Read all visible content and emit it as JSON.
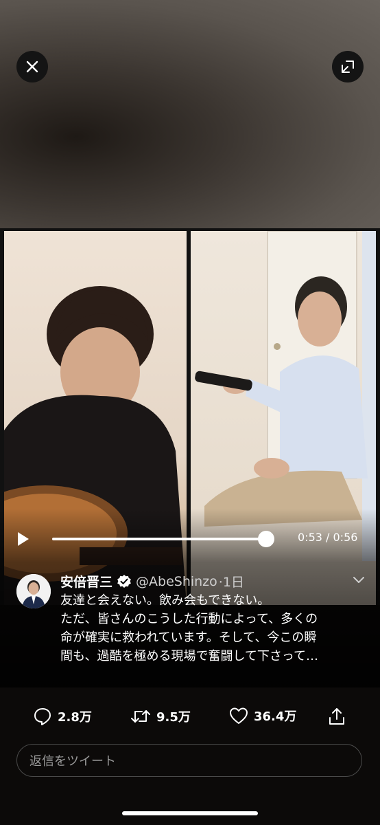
{
  "player": {
    "current_time": "0:53",
    "duration": "0:56",
    "time_label": "0:53 / 0:56",
    "progress": 0.946
  },
  "tweet": {
    "author_name": "安倍晋三",
    "handle": "@AbeShinzo",
    "time_ago": "·1日",
    "text_lines": [
      "友達と会えない。飲み会もできない。",
      "ただ、皆さんのこうした行動によって、多くの",
      "命が確実に救われています。そして、今この瞬",
      "間も、過酷を極める現場で奮闘して下さって…"
    ]
  },
  "actions": {
    "replies": "2.8万",
    "retweets": "9.5万",
    "likes": "36.4万"
  },
  "reply_box": {
    "placeholder": "返信をツイート"
  },
  "icons": {
    "close": "close-icon",
    "exit_fullscreen": "minimize-icon",
    "play": "play-icon",
    "verified": "verified-badge-icon",
    "more": "chevron-down-icon",
    "reply": "reply-icon",
    "retweet": "retweet-icon",
    "like": "heart-icon",
    "share": "share-icon"
  },
  "colors": {
    "background": "#0b0908",
    "text": "#ffffff",
    "secondary_text": "#cfcfcf",
    "placeholder": "#9a9a9a"
  }
}
